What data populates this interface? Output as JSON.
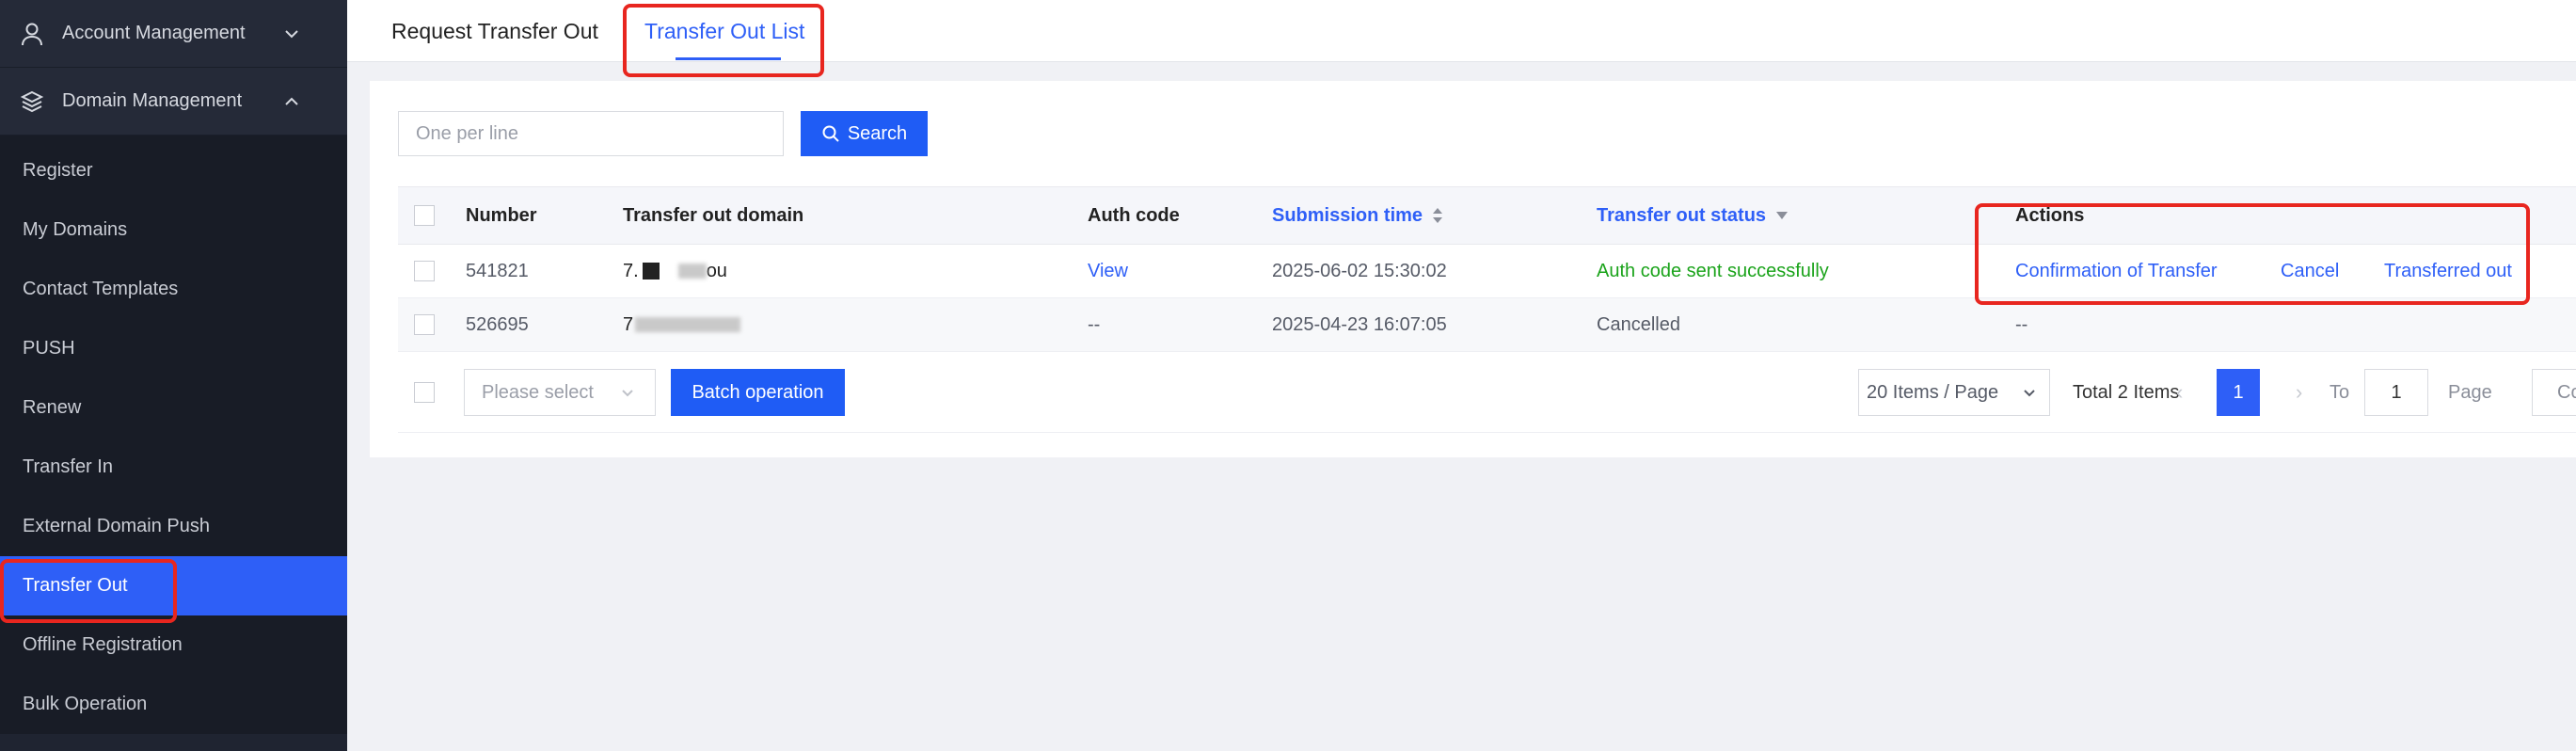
{
  "sidebar": {
    "groups": [
      {
        "label": "Account Management",
        "icon": "user-icon",
        "expanded": false
      },
      {
        "label": "Domain Management",
        "icon": "layers-icon",
        "expanded": true
      }
    ],
    "items": [
      {
        "label": "Register"
      },
      {
        "label": "My Domains"
      },
      {
        "label": "Contact Templates"
      },
      {
        "label": "PUSH"
      },
      {
        "label": "Renew"
      },
      {
        "label": "Transfer In"
      },
      {
        "label": "External Domain Push"
      },
      {
        "label": "Transfer Out",
        "active": true
      },
      {
        "label": "Offline Registration"
      },
      {
        "label": "Bulk Operation"
      }
    ]
  },
  "tabs": [
    {
      "label": "Request Transfer Out"
    },
    {
      "label": "Transfer Out List",
      "active": true
    }
  ],
  "search": {
    "placeholder": "One per line",
    "button_label": "Search"
  },
  "table": {
    "columns": [
      "Number",
      "Transfer out domain",
      "Auth code",
      "Submission time",
      "Transfer out status",
      "Actions"
    ],
    "rows": [
      {
        "number": "541821",
        "domain_prefix": "7.",
        "domain_suffix": "ou",
        "auth_code": "View",
        "submission_time": "2025-06-02 15:30:02",
        "status": "Auth code sent successfully",
        "actions": [
          "Confirmation of Transfer",
          "Cancel",
          "Transferred out"
        ]
      },
      {
        "number": "526695",
        "domain_prefix": "7",
        "domain_suffix": "",
        "auth_code": "--",
        "submission_time": "2025-04-23 16:07:05",
        "status": "Cancelled",
        "actions_placeholder": "--"
      }
    ]
  },
  "footer": {
    "select_placeholder": "Please select",
    "batch_label": "Batch operation",
    "page_size": "20 Items / Page",
    "total": "Total 2 Items",
    "current_page": "1",
    "to_label": "To",
    "jump_value": "1",
    "page_label": "Page",
    "confirm_label": "Confi"
  },
  "colors": {
    "accent": "#2e5ff7",
    "sidebar_bg": "#1f2431",
    "success": "#1aa31a",
    "highlight": "#e8261f"
  }
}
